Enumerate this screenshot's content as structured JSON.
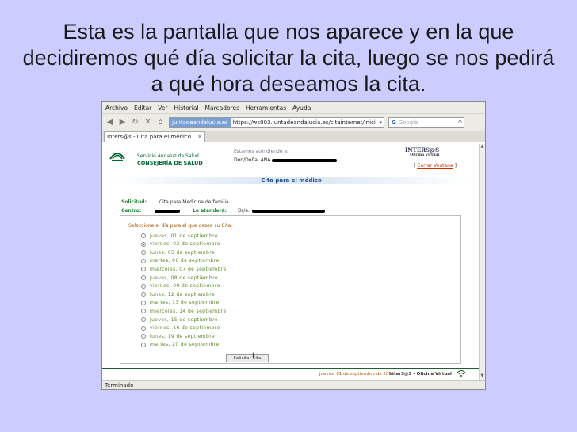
{
  "slide": {
    "title": "Esta es la pantalla que nos aparece y en la que decidiremos qué día solicitar la cita, luego se nos pedirá a qué hora deseamos la cita."
  },
  "browser": {
    "menu": [
      "Archivo",
      "Editar",
      "Ver",
      "Historial",
      "Marcadores",
      "Herramientas",
      "Ayuda"
    ],
    "url_site": "juntadeandalucia.es",
    "url": "https://ws003.juntadeandalucia.es/citainternet/inici",
    "search_placeholder": "Google",
    "tab_title": "Inters@s - Cita para el médico",
    "status": "Terminado"
  },
  "page": {
    "org_line1": "Servicio Andaluz de Salud",
    "org_line2": "CONSEJERÍA DE SALUD",
    "attending_label": "Estamos atendiendo a:",
    "attending_name": "Don/Doña.  ANA",
    "brand": "INTERS@S",
    "brand_sub": "Oficina Virtual",
    "close_label": "Cerrar Ventana",
    "heading": "Cita para el médico",
    "solicitud_label": "Solicitud:",
    "solicitud_value": "Cita para Medicina de familia",
    "centro_label": "Centro:",
    "atendera_label": "Le atenderá:",
    "atendera_value": "Dr/a.",
    "prompt": "Seleccione el día para el que desea su Cita:",
    "days": [
      "jueves,  01  de  septiembre",
      "viernes,  02  de  septiembre",
      "lunes,  05  de  septiembre",
      "martes,  06  de  septiembre",
      "miércoles,  07  de  septiembre",
      "jueves,  08  de  septiembre",
      "viernes,  09  de  septiembre",
      "lunes,  12  de  septiembre",
      "martes,  13  de  septiembre",
      "miércoles,  14  de  septiembre",
      "jueves,  15  de  septiembre",
      "viernes,  16  de  septiembre",
      "lunes,  19  de  septiembre",
      "martes,  20  de  septiembre"
    ],
    "selected_index": 1,
    "submit_label": "Solicitar Cita",
    "footer_date": "jueves, 01 de septiembre de 2011",
    "footer_brand": "InterS@S - Oficina Virtual"
  },
  "colors": {
    "slide_bg": "#ccccff",
    "sas_green": "#006633",
    "heading_blue": "#1f4f87",
    "day_green": "#5a8a2a",
    "prompt_orange": "#aa5500"
  }
}
